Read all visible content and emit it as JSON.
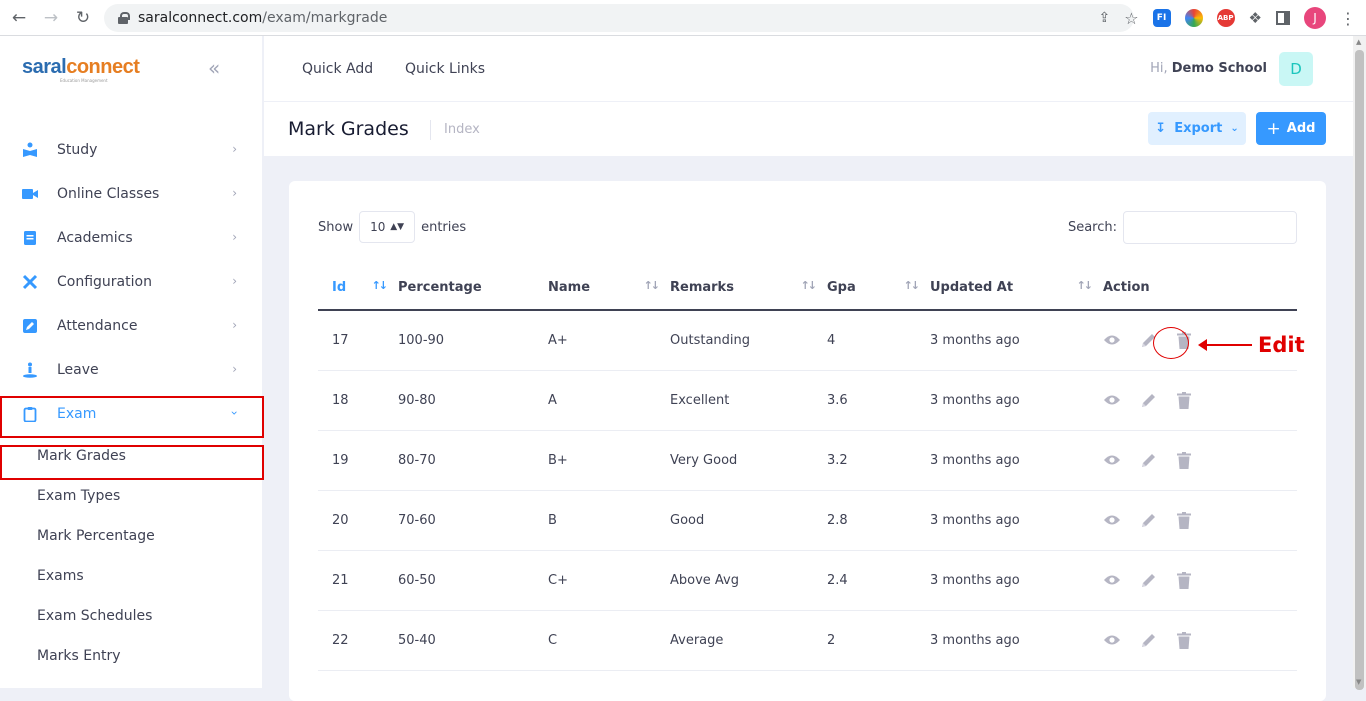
{
  "browser": {
    "url_host": "saralconnect.com",
    "url_path": "/exam/markgrade",
    "profile_initial": "J"
  },
  "sidebar": {
    "logo_part1": "saral",
    "logo_part2": "connect",
    "logo_sub": "Education Management",
    "items": [
      {
        "label": "Study",
        "icon": "book-reader-icon"
      },
      {
        "label": "Online Classes",
        "icon": "video-camera-icon"
      },
      {
        "label": "Academics",
        "icon": "notebook-icon"
      },
      {
        "label": "Configuration",
        "icon": "tools-icon"
      },
      {
        "label": "Attendance",
        "icon": "pencil-square-icon"
      },
      {
        "label": "Leave",
        "icon": "person-leave-icon"
      },
      {
        "label": "Exam",
        "icon": "clipboard-icon"
      }
    ],
    "exam_subitems": [
      "Mark Grades",
      "Exam Types",
      "Mark Percentage",
      "Exams",
      "Exam Schedules",
      "Marks Entry"
    ]
  },
  "topbar": {
    "quick_add": "Quick Add",
    "quick_links": "Quick Links",
    "greeting": "Hi,",
    "user_name": "Demo School",
    "avatar_initial": "D"
  },
  "subheader": {
    "title": "Mark Grades",
    "breadcrumb": "Index",
    "export_label": "Export",
    "add_label": "Add"
  },
  "table_controls": {
    "show_label": "Show",
    "entries_value": "10",
    "entries_label": "entries",
    "search_label": "Search:"
  },
  "table": {
    "headers": [
      "Id",
      "Percentage",
      "Name",
      "Remarks",
      "Gpa",
      "Updated At",
      "Action"
    ],
    "rows": [
      {
        "id": "17",
        "percentage": "100-90",
        "name": "A+",
        "remarks": "Outstanding",
        "gpa": "4",
        "updated": "3 months ago"
      },
      {
        "id": "18",
        "percentage": "90-80",
        "name": "A",
        "remarks": "Excellent",
        "gpa": "3.6",
        "updated": "3 months ago"
      },
      {
        "id": "19",
        "percentage": "80-70",
        "name": "B+",
        "remarks": "Very Good",
        "gpa": "3.2",
        "updated": "3 months ago"
      },
      {
        "id": "20",
        "percentage": "70-60",
        "name": "B",
        "remarks": "Good",
        "gpa": "2.8",
        "updated": "3 months ago"
      },
      {
        "id": "21",
        "percentage": "60-50",
        "name": "C+",
        "remarks": "Above Avg",
        "gpa": "2.4",
        "updated": "3 months ago"
      },
      {
        "id": "22",
        "percentage": "50-40",
        "name": "C",
        "remarks": "Average",
        "gpa": "2",
        "updated": "3 months ago"
      }
    ]
  },
  "annotation": {
    "edit_label": "Edit"
  },
  "colors": {
    "accent": "#3699ff",
    "highlight": "#e00000"
  }
}
